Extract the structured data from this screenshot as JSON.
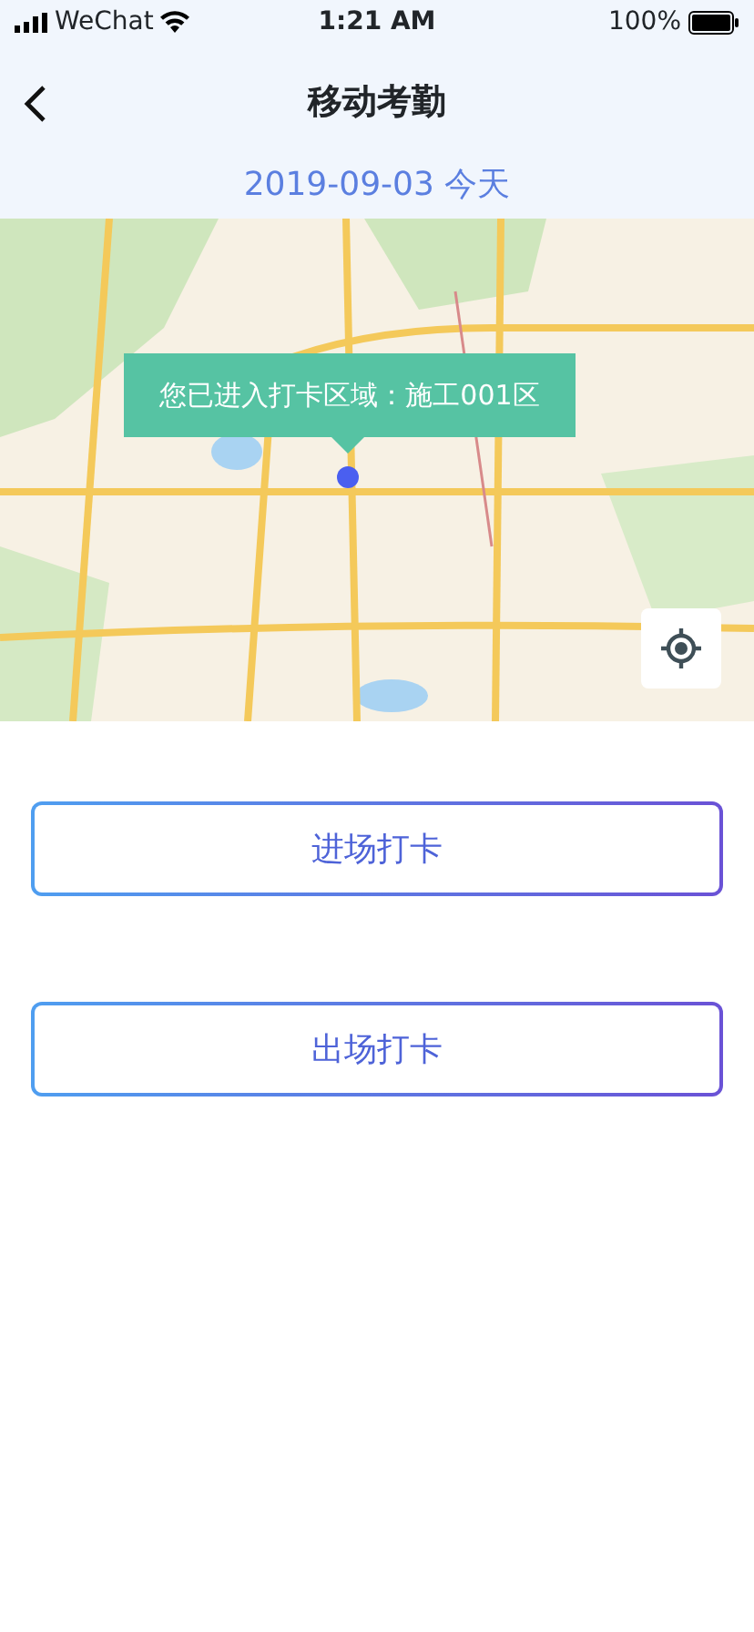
{
  "status_bar": {
    "carrier": "WeChat",
    "time": "1:21 AM",
    "battery": "100%"
  },
  "nav": {
    "title": "移动考勤"
  },
  "date": "2019-09-03 今天",
  "map": {
    "kind": "picture",
    "notice": "您已进入打卡区域：施工001区"
  },
  "buttons": [
    "进场打卡",
    "出场打卡"
  ]
}
